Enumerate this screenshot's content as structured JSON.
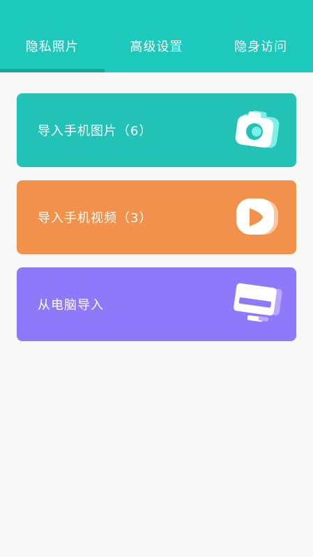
{
  "tabs": [
    {
      "label": "隐私照片",
      "active": true
    },
    {
      "label": "高级设置",
      "active": false
    },
    {
      "label": "隐身访问",
      "active": false
    }
  ],
  "cards": {
    "photos": {
      "label": "导入手机图片（6）",
      "icon": "camera-icon",
      "color": "#22c2b7"
    },
    "videos": {
      "label": "导入手机视频（3）",
      "icon": "video-play-icon",
      "color": "#f1914b"
    },
    "pc": {
      "label": "从电脑导入",
      "icon": "monitor-icon",
      "color": "#8f79fb"
    }
  },
  "colors": {
    "header": "#1cc9bb",
    "tab_indicator": "#15a69a",
    "background": "#f8f8f8"
  }
}
